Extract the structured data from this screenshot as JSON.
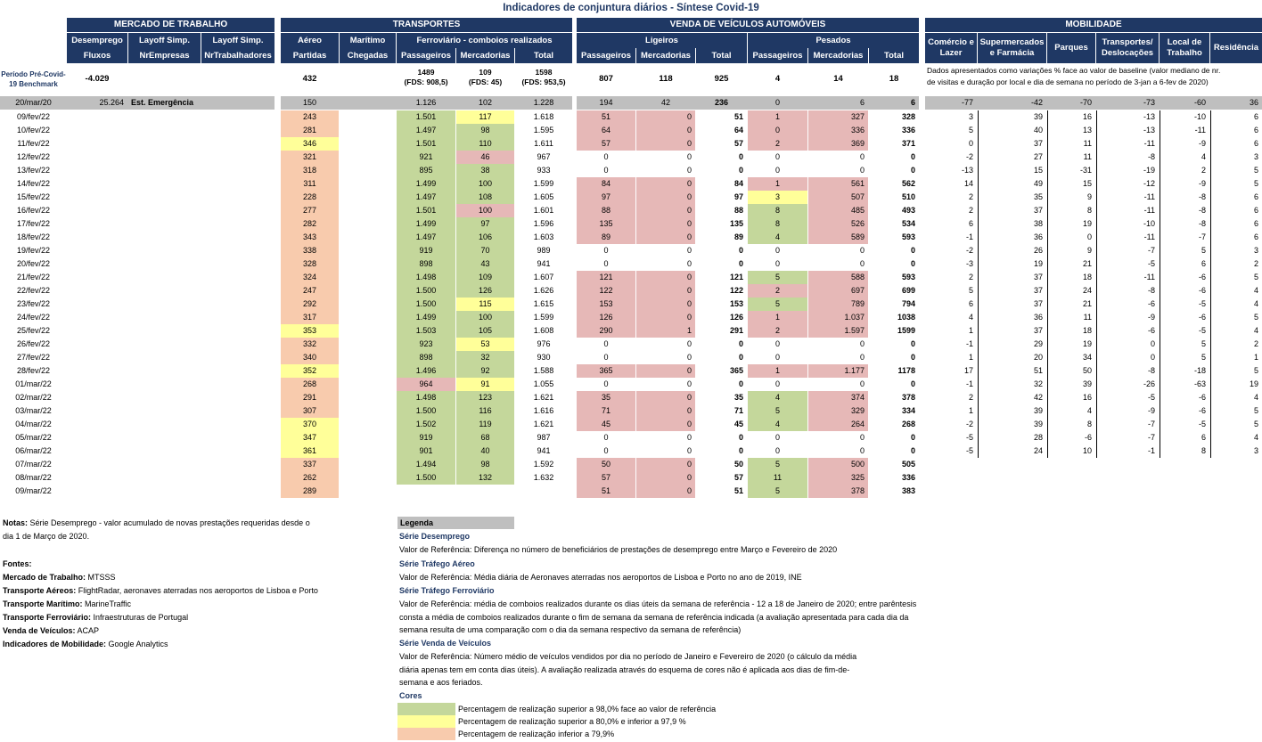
{
  "title": "Indicadores de conjuntura diários - Síntese Covid-19",
  "sections": {
    "mercado": "MERCADO DE TRABALHO",
    "transportes": "TRANSPORTES",
    "veiculos": "VENDA DE VEÍCULOS AUTOMÓVEIS",
    "mobilidade": "MOBILIDADE"
  },
  "headers2": {
    "desemprego": "Desemprego",
    "layoff1": "Layoff Simp.",
    "layoff2": "Layoff Simp.",
    "aereo": "Aéreo",
    "maritimo": "Marítimo",
    "ferroviario": "Ferroviário - comboios realizados",
    "ligeiros": "Ligeiros",
    "pesados": "Pesados"
  },
  "headers3": {
    "fluxos": "Fluxos",
    "nrempresas": "NrEmpresas",
    "nrtrabalhadores": "NrTrabalhadores",
    "partidas": "Partidas",
    "chegadas": "Chegadas",
    "f_pass": "Passageiros",
    "f_merc": "Mercadorias",
    "f_total": "Total",
    "l_pass": "Passageiros",
    "l_merc": "Mercadorias",
    "l_total": "Total",
    "p_pass": "Passageiros",
    "p_merc": "Mercadorias",
    "p_total": "Total"
  },
  "mob_headers": [
    "Comércio e Lazer",
    "Supermercados e Farmácia",
    "Parques",
    "Transportes/ Deslocações",
    "Local de Trabalho",
    "Residência"
  ],
  "benchmark": {
    "label1": "Período Pré-Covid-",
    "label2": "19 Benchmark",
    "fluxos": "-4.029",
    "partidas": "432",
    "f_pass": "1489",
    "f_pass_sub": "(FDS: 908,5)",
    "f_merc": "109",
    "f_merc_sub": "(FDS: 45)",
    "f_total": "1598",
    "f_total_sub": "(FDS: 953,5)",
    "l_pass": "807",
    "l_merc": "118",
    "l_total": "925",
    "p_pass": "4",
    "p_merc": "14",
    "p_total": "18",
    "mob_note1": "Dados apresentados como variações % face ao valor de baseline (valor mediano de nr.",
    "mob_note2": "de visitas e duração por local e dia de semana no período de 3-jan a 6-fev de 2020)"
  },
  "emergencia": {
    "date": "20/mar/20",
    "fluxos": "25.264",
    "label": "Est. Emergência",
    "partidas": "150",
    "f_pass": "1.126",
    "f_merc": "102",
    "f_total": "1.228",
    "l_pass": "194",
    "l_merc": "42",
    "l_total": "236",
    "p_pass": "0",
    "p_merc": "6",
    "p_total": "6",
    "mob": [
      "-77",
      "-42",
      "-70",
      "-73",
      "-60",
      "36"
    ]
  },
  "rows": [
    {
      "d": "09/fev/22",
      "a": "243",
      "ac": "o",
      "fp": "1.501",
      "fpc": "g",
      "fm": "117",
      "fmc": "y",
      "ft": "1.618",
      "lp": "51",
      "lpc": "p",
      "lm": "0",
      "lmc": "p",
      "lt": "51",
      "pp": "1",
      "ppc": "p",
      "pm": "327",
      "pmc": "p",
      "pt": "328",
      "m": [
        "3",
        "39",
        "16",
        "-13",
        "-10",
        "6"
      ]
    },
    {
      "d": "10/fev/22",
      "a": "281",
      "ac": "o",
      "fp": "1.497",
      "fpc": "g",
      "fm": "98",
      "fmc": "g",
      "ft": "1.595",
      "lp": "64",
      "lpc": "p",
      "lm": "0",
      "lmc": "p",
      "lt": "64",
      "pp": "0",
      "ppc": "p",
      "pm": "336",
      "pmc": "p",
      "pt": "336",
      "m": [
        "5",
        "40",
        "13",
        "-13",
        "-11",
        "6"
      ]
    },
    {
      "d": "11/fev/22",
      "a": "346",
      "ac": "y",
      "fp": "1.501",
      "fpc": "g",
      "fm": "110",
      "fmc": "g",
      "ft": "1.611",
      "lp": "57",
      "lpc": "p",
      "lm": "0",
      "lmc": "p",
      "lt": "57",
      "pp": "2",
      "ppc": "p",
      "pm": "369",
      "pmc": "p",
      "pt": "371",
      "m": [
        "0",
        "37",
        "11",
        "-11",
        "-9",
        "6"
      ]
    },
    {
      "d": "12/fev/22",
      "a": "321",
      "ac": "o",
      "fp": "921",
      "fpc": "g",
      "fm": "46",
      "fmc": "p",
      "ft": "967",
      "lp": "0",
      "lpc": "",
      "lm": "0",
      "lmc": "",
      "lt": "0",
      "pp": "0",
      "ppc": "",
      "pm": "0",
      "pmc": "",
      "pt": "0",
      "m": [
        "-2",
        "27",
        "11",
        "-8",
        "4",
        "3"
      ]
    },
    {
      "d": "13/fev/22",
      "a": "318",
      "ac": "o",
      "fp": "895",
      "fpc": "g",
      "fm": "38",
      "fmc": "g",
      "ft": "933",
      "lp": "0",
      "lpc": "",
      "lm": "0",
      "lmc": "",
      "lt": "0",
      "pp": "0",
      "ppc": "",
      "pm": "0",
      "pmc": "",
      "pt": "0",
      "m": [
        "-13",
        "15",
        "-31",
        "-19",
        "2",
        "5"
      ]
    },
    {
      "d": "14/fev/22",
      "a": "311",
      "ac": "o",
      "fp": "1.499",
      "fpc": "g",
      "fm": "100",
      "fmc": "g",
      "ft": "1.599",
      "lp": "84",
      "lpc": "p",
      "lm": "0",
      "lmc": "p",
      "lt": "84",
      "pp": "1",
      "ppc": "p",
      "pm": "561",
      "pmc": "p",
      "pt": "562",
      "m": [
        "14",
        "49",
        "15",
        "-12",
        "-9",
        "5"
      ]
    },
    {
      "d": "15/fev/22",
      "a": "228",
      "ac": "o",
      "fp": "1.497",
      "fpc": "g",
      "fm": "108",
      "fmc": "g",
      "ft": "1.605",
      "lp": "97",
      "lpc": "p",
      "lm": "0",
      "lmc": "p",
      "lt": "97",
      "pp": "3",
      "ppc": "y",
      "pm": "507",
      "pmc": "p",
      "pt": "510",
      "m": [
        "2",
        "35",
        "9",
        "-11",
        "-8",
        "6"
      ]
    },
    {
      "d": "16/fev/22",
      "a": "277",
      "ac": "o",
      "fp": "1.501",
      "fpc": "g",
      "fm": "100",
      "fmc": "p",
      "ft": "1.601",
      "lp": "88",
      "lpc": "p",
      "lm": "0",
      "lmc": "p",
      "lt": "88",
      "pp": "8",
      "ppc": "g",
      "pm": "485",
      "pmc": "p",
      "pt": "493",
      "m": [
        "2",
        "37",
        "8",
        "-11",
        "-8",
        "6"
      ]
    },
    {
      "d": "17/fev/22",
      "a": "282",
      "ac": "o",
      "fp": "1.499",
      "fpc": "g",
      "fm": "97",
      "fmc": "g",
      "ft": "1.596",
      "lp": "135",
      "lpc": "p",
      "lm": "0",
      "lmc": "p",
      "lt": "135",
      "pp": "8",
      "ppc": "g",
      "pm": "526",
      "pmc": "p",
      "pt": "534",
      "m": [
        "6",
        "38",
        "19",
        "-10",
        "-8",
        "6"
      ]
    },
    {
      "d": "18/fev/22",
      "a": "343",
      "ac": "o",
      "fp": "1.497",
      "fpc": "g",
      "fm": "106",
      "fmc": "g",
      "ft": "1.603",
      "lp": "89",
      "lpc": "p",
      "lm": "0",
      "lmc": "p",
      "lt": "89",
      "pp": "4",
      "ppc": "g",
      "pm": "589",
      "pmc": "p",
      "pt": "593",
      "m": [
        "-1",
        "36",
        "0",
        "-11",
        "-7",
        "6"
      ]
    },
    {
      "d": "19/fev/22",
      "a": "338",
      "ac": "o",
      "fp": "919",
      "fpc": "g",
      "fm": "70",
      "fmc": "g",
      "ft": "989",
      "lp": "0",
      "lpc": "",
      "lm": "0",
      "lmc": "",
      "lt": "0",
      "pp": "0",
      "ppc": "",
      "pm": "0",
      "pmc": "",
      "pt": "0",
      "m": [
        "-2",
        "26",
        "9",
        "-7",
        "5",
        "3"
      ]
    },
    {
      "d": "20/fev/22",
      "a": "328",
      "ac": "o",
      "fp": "898",
      "fpc": "g",
      "fm": "43",
      "fmc": "g",
      "ft": "941",
      "lp": "0",
      "lpc": "",
      "lm": "0",
      "lmc": "",
      "lt": "0",
      "pp": "0",
      "ppc": "",
      "pm": "0",
      "pmc": "",
      "pt": "0",
      "m": [
        "-3",
        "19",
        "21",
        "-5",
        "6",
        "2"
      ]
    },
    {
      "d": "21/fev/22",
      "a": "324",
      "ac": "o",
      "fp": "1.498",
      "fpc": "g",
      "fm": "109",
      "fmc": "g",
      "ft": "1.607",
      "lp": "121",
      "lpc": "p",
      "lm": "0",
      "lmc": "p",
      "lt": "121",
      "pp": "5",
      "ppc": "g",
      "pm": "588",
      "pmc": "p",
      "pt": "593",
      "m": [
        "2",
        "37",
        "18",
        "-11",
        "-6",
        "5"
      ]
    },
    {
      "d": "22/fev/22",
      "a": "247",
      "ac": "o",
      "fp": "1.500",
      "fpc": "g",
      "fm": "126",
      "fmc": "g",
      "ft": "1.626",
      "lp": "122",
      "lpc": "p",
      "lm": "0",
      "lmc": "p",
      "lt": "122",
      "pp": "2",
      "ppc": "p",
      "pm": "697",
      "pmc": "p",
      "pt": "699",
      "m": [
        "5",
        "37",
        "24",
        "-8",
        "-6",
        "4"
      ]
    },
    {
      "d": "23/fev/22",
      "a": "292",
      "ac": "o",
      "fp": "1.500",
      "fpc": "g",
      "fm": "115",
      "fmc": "y",
      "ft": "1.615",
      "lp": "153",
      "lpc": "p",
      "lm": "0",
      "lmc": "p",
      "lt": "153",
      "pp": "5",
      "ppc": "g",
      "pm": "789",
      "pmc": "p",
      "pt": "794",
      "m": [
        "6",
        "37",
        "21",
        "-6",
        "-5",
        "4"
      ]
    },
    {
      "d": "24/fev/22",
      "a": "317",
      "ac": "o",
      "fp": "1.499",
      "fpc": "g",
      "fm": "100",
      "fmc": "g",
      "ft": "1.599",
      "lp": "126",
      "lpc": "p",
      "lm": "0",
      "lmc": "p",
      "lt": "126",
      "pp": "1",
      "ppc": "p",
      "pm": "1.037",
      "pmc": "p",
      "pt": "1038",
      "m": [
        "4",
        "36",
        "11",
        "-9",
        "-6",
        "5"
      ]
    },
    {
      "d": "25/fev/22",
      "a": "353",
      "ac": "y",
      "fp": "1.503",
      "fpc": "g",
      "fm": "105",
      "fmc": "g",
      "ft": "1.608",
      "lp": "290",
      "lpc": "p",
      "lm": "1",
      "lmc": "p",
      "lt": "291",
      "pp": "2",
      "ppc": "p",
      "pm": "1.597",
      "pmc": "p",
      "pt": "1599",
      "m": [
        "1",
        "37",
        "18",
        "-6",
        "-5",
        "4"
      ]
    },
    {
      "d": "26/fev/22",
      "a": "332",
      "ac": "o",
      "fp": "923",
      "fpc": "g",
      "fm": "53",
      "fmc": "y",
      "ft": "976",
      "lp": "0",
      "lpc": "",
      "lm": "0",
      "lmc": "",
      "lt": "0",
      "pp": "0",
      "ppc": "",
      "pm": "0",
      "pmc": "",
      "pt": "0",
      "m": [
        "-1",
        "29",
        "19",
        "0",
        "5",
        "2"
      ]
    },
    {
      "d": "27/fev/22",
      "a": "340",
      "ac": "o",
      "fp": "898",
      "fpc": "g",
      "fm": "32",
      "fmc": "g",
      "ft": "930",
      "lp": "0",
      "lpc": "",
      "lm": "0",
      "lmc": "",
      "lt": "0",
      "pp": "0",
      "ppc": "",
      "pm": "0",
      "pmc": "",
      "pt": "0",
      "m": [
        "1",
        "20",
        "34",
        "0",
        "5",
        "1"
      ]
    },
    {
      "d": "28/fev/22",
      "a": "352",
      "ac": "y",
      "fp": "1.496",
      "fpc": "g",
      "fm": "92",
      "fmc": "g",
      "ft": "1.588",
      "lp": "365",
      "lpc": "p",
      "lm": "0",
      "lmc": "p",
      "lt": "365",
      "pp": "1",
      "ppc": "p",
      "pm": "1.177",
      "pmc": "p",
      "pt": "1178",
      "m": [
        "17",
        "51",
        "50",
        "-8",
        "-18",
        "5"
      ]
    },
    {
      "d": "01/mar/22",
      "a": "268",
      "ac": "o",
      "fp": "964",
      "fpc": "p",
      "fm": "91",
      "fmc": "y",
      "ft": "1.055",
      "lp": "0",
      "lpc": "",
      "lm": "0",
      "lmc": "",
      "lt": "0",
      "pp": "0",
      "ppc": "",
      "pm": "0",
      "pmc": "",
      "pt": "0",
      "m": [
        "-1",
        "32",
        "39",
        "-26",
        "-63",
        "19"
      ]
    },
    {
      "d": "02/mar/22",
      "a": "291",
      "ac": "o",
      "fp": "1.498",
      "fpc": "g",
      "fm": "123",
      "fmc": "g",
      "ft": "1.621",
      "lp": "35",
      "lpc": "p",
      "lm": "0",
      "lmc": "p",
      "lt": "35",
      "pp": "4",
      "ppc": "g",
      "pm": "374",
      "pmc": "p",
      "pt": "378",
      "m": [
        "2",
        "42",
        "16",
        "-5",
        "-6",
        "4"
      ]
    },
    {
      "d": "03/mar/22",
      "a": "307",
      "ac": "o",
      "fp": "1.500",
      "fpc": "g",
      "fm": "116",
      "fmc": "g",
      "ft": "1.616",
      "lp": "71",
      "lpc": "p",
      "lm": "0",
      "lmc": "p",
      "lt": "71",
      "pp": "5",
      "ppc": "g",
      "pm": "329",
      "pmc": "p",
      "pt": "334",
      "m": [
        "1",
        "39",
        "4",
        "-9",
        "-6",
        "5"
      ]
    },
    {
      "d": "04/mar/22",
      "a": "370",
      "ac": "y",
      "fp": "1.502",
      "fpc": "g",
      "fm": "119",
      "fmc": "g",
      "ft": "1.621",
      "lp": "45",
      "lpc": "p",
      "lm": "0",
      "lmc": "p",
      "lt": "45",
      "pp": "4",
      "ppc": "g",
      "pm": "264",
      "pmc": "p",
      "pt": "268",
      "m": [
        "-2",
        "39",
        "8",
        "-7",
        "-5",
        "5"
      ]
    },
    {
      "d": "05/mar/22",
      "a": "347",
      "ac": "y",
      "fp": "919",
      "fpc": "g",
      "fm": "68",
      "fmc": "g",
      "ft": "987",
      "lp": "0",
      "lpc": "",
      "lm": "0",
      "lmc": "",
      "lt": "0",
      "pp": "0",
      "ppc": "",
      "pm": "0",
      "pmc": "",
      "pt": "0",
      "m": [
        "-5",
        "28",
        "-6",
        "-7",
        "6",
        "4"
      ]
    },
    {
      "d": "06/mar/22",
      "a": "361",
      "ac": "y",
      "fp": "901",
      "fpc": "g",
      "fm": "40",
      "fmc": "g",
      "ft": "941",
      "lp": "0",
      "lpc": "",
      "lm": "0",
      "lmc": "",
      "lt": "0",
      "pp": "0",
      "ppc": "",
      "pm": "0",
      "pmc": "",
      "pt": "0",
      "m": [
        "-5",
        "24",
        "10",
        "-1",
        "8",
        "3"
      ]
    },
    {
      "d": "07/mar/22",
      "a": "337",
      "ac": "o",
      "fp": "1.494",
      "fpc": "g",
      "fm": "98",
      "fmc": "g",
      "ft": "1.592",
      "lp": "50",
      "lpc": "p",
      "lm": "0",
      "lmc": "p",
      "lt": "50",
      "pp": "5",
      "ppc": "g",
      "pm": "500",
      "pmc": "p",
      "pt": "505",
      "m": []
    },
    {
      "d": "08/mar/22",
      "a": "262",
      "ac": "o",
      "fp": "1.500",
      "fpc": "g",
      "fm": "132",
      "fmc": "g",
      "ft": "1.632",
      "lp": "57",
      "lpc": "p",
      "lm": "0",
      "lmc": "p",
      "lt": "57",
      "pp": "11",
      "ppc": "g",
      "pm": "325",
      "pmc": "p",
      "pt": "336",
      "m": []
    },
    {
      "d": "09/mar/22",
      "a": "289",
      "ac": "o",
      "fp": "",
      "fpc": "",
      "fm": "",
      "fmc": "",
      "ft": "",
      "lp": "51",
      "lpc": "p",
      "lm": "0",
      "lmc": "p",
      "lt": "51",
      "pp": "5",
      "ppc": "g",
      "pm": "378",
      "pmc": "p",
      "pt": "383",
      "m": []
    }
  ],
  "notes": {
    "line1_bold": "Notas:",
    "line1": " Série Desemprego - valor acumulado de novas prestações requeridas desde o",
    "line2": "dia 1 de Março de 2020.",
    "fontes": "Fontes:",
    "sources": [
      {
        "k": "Mercado de Trabalho:",
        "v": " MTSSS"
      },
      {
        "k": "Transporte Aéreos:",
        "v": " FlightRadar, aeronaves aterradas nos aeroportos de Lisboa e Porto"
      },
      {
        "k": "Transporte Marítimo:",
        "v": " MarineTraffic"
      },
      {
        "k": "Transporte Ferroviário:",
        "v": " Infraestruturas de Portugal"
      },
      {
        "k": "Venda de Veículos:",
        "v": " ACAP"
      },
      {
        "k": "Indicadores de Mobilidade:",
        "v": " Google Analytics"
      }
    ]
  },
  "legend": {
    "title": "Legenda",
    "s1": "Série Desemprego",
    "s1t": "Valor de Referência: Diferença no número de beneficiários de prestações de desemprego entre Março e Fevereiro de 2020",
    "s2": "Série Tráfego Aéreo",
    "s2t": "Valor de Referência: Média diária de Aeronaves aterradas nos aeroportos de Lisboa e Porto no ano de 2019, INE",
    "s3": "Série Tráfego Ferroviário",
    "s3t1": "Valor de Referência: média de comboios realizados durante os dias úteis da semana de referência - 12 a 18 de Janeiro de 2020; entre parêntesis",
    "s3t2": "consta a média de comboios realizados durante o fim de semana da semana de referência indicada (a avaliação apresentada para cada dia da",
    "s3t3": "semana resulta de uma comparação com o dia da semana respectivo da semana de referência)",
    "s4": "Série Venda de Veículos",
    "s4t1": "Valor de Referência: Número médio de veículos vendidos por dia no período de Janeiro e Fevereiro de 2020 (o cálculo da média",
    "s4t2": "diária apenas tem em conta dias úteis). A avaliação realizada através do esquema de cores não é aplicada aos dias de fim-de-",
    "s4t3": "semana e aos feriados.",
    "cores": "Cores",
    "c1": "Percentagem de realização superior a 98,0% face ao valor de referência",
    "c2": "Percentagem de realização superior a 80,0% e inferior a 97,9 %",
    "c3": "Percentagem de realização inferior a 79,9%",
    "c1color": "#c4d79b",
    "c2color": "#ffff99",
    "c3color": "#f8cbad"
  }
}
